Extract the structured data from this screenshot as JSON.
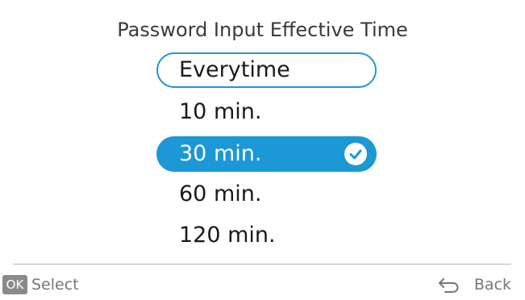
{
  "screen": {
    "title": "Password Input Effective Time"
  },
  "options": [
    {
      "label": "Everytime",
      "state": "focused"
    },
    {
      "label": "10 min.",
      "state": "normal"
    },
    {
      "label": "30 min.",
      "state": "selected"
    },
    {
      "label": "60 min.",
      "state": "normal"
    },
    {
      "label": "120 min.",
      "state": "normal"
    }
  ],
  "footer": {
    "ok_key": "OK",
    "select_label": "Select",
    "back_label": "Back"
  },
  "colors": {
    "accent": "#1b98d5",
    "focus_border": "#1f97d3",
    "footer_text": "#777777"
  },
  "icons": {
    "selected_check": "check-circle-icon",
    "back": "back-arrow-icon"
  }
}
